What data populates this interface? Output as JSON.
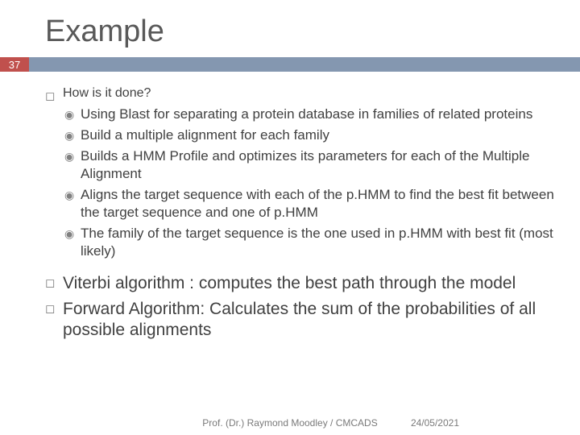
{
  "title": "Example",
  "page_number": "37",
  "bullets": [
    {
      "text": "How is it done?",
      "children": [
        "Using Blast for separating a protein database in families of related proteins",
        "Build a multiple alignment for each family",
        "Builds a HMM Profile and optimizes its parameters for each of the Multiple Alignment",
        "Aligns the target sequence with each of the p.HMM to find the best fit between the target sequence and one of p.HMM",
        "The family of the target sequence is the one used in p.HMM with best fit (most likely)"
      ]
    },
    {
      "text": "Viterbi algorithm : computes the best path through the model"
    },
    {
      "text": "Forward Algorithm: Calculates the sum of the probabilities of all possible alignments"
    }
  ],
  "footer": {
    "center": "Prof. (Dr.) Raymond Moodley / CMCADS",
    "date": "24/05/2021"
  }
}
